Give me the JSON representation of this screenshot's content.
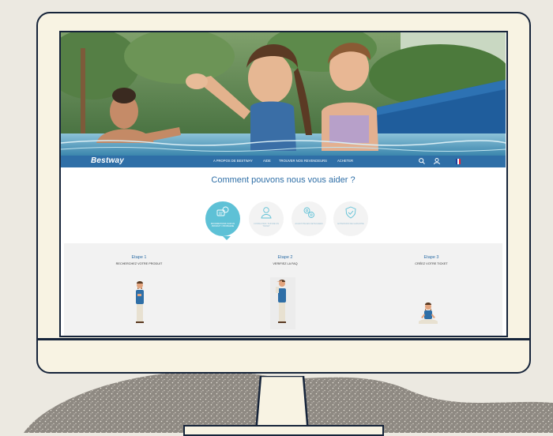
{
  "colors": {
    "brand_blue": "#2f6fa7",
    "active_teal": "#5ec1d6",
    "frame_navy": "#16243a",
    "monitor_cream": "#f8f3e3",
    "background": "#ece9e1"
  },
  "site": {
    "logo": "Bestway",
    "nav": {
      "items": [
        "A PROPOS DE BESTWAY",
        "AIDE",
        "TROUVER NOS REVENDEURS",
        "ACHETER"
      ],
      "icons": [
        "search-icon",
        "user-icon",
        "france-flag-icon"
      ]
    },
    "heading": "Comment pouvons nous vous aider ?",
    "categories": [
      {
        "label": "INFORMATIONS SUR UN PRODUIT / PROBLEME",
        "icon": "chat-bubble-icon",
        "active": true
      },
      {
        "label": "CONSULTER / SUIVRE UN TICKET",
        "icon": "user-icon",
        "active": false
      },
      {
        "label": "ACHAT PIECES DETACHEES",
        "icon": "spare-parts-icon",
        "active": false
      },
      {
        "label": "EXTENSION DE GARANTIE",
        "icon": "shield-check-icon",
        "active": false
      }
    ],
    "steps": [
      {
        "title": "Etape 1",
        "subtitle": "RECHERCHEZ VOTRE PRODUIT"
      },
      {
        "title": "Etape 2",
        "subtitle": "VERIFIEZ LA FAQ"
      },
      {
        "title": "Etape 3",
        "subtitle": "CRÉEZ VOTRE TICKET"
      }
    ]
  }
}
